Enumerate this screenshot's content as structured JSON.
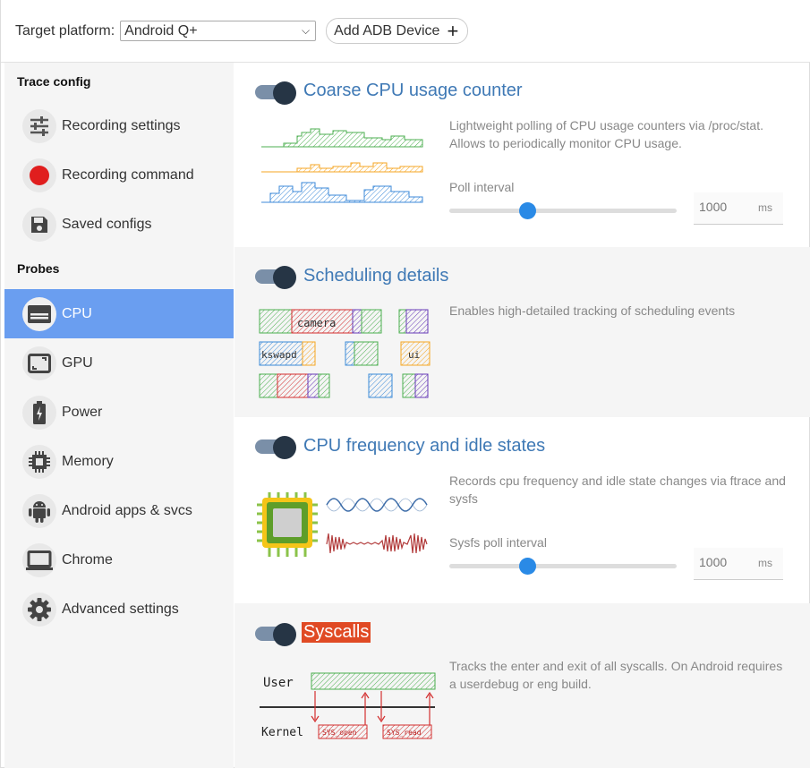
{
  "header": {
    "target_label": "Target platform:",
    "platform_value": "Android Q+",
    "add_device_label": "Add ADB Device",
    "add_icon": "plus-icon"
  },
  "sidebar": {
    "trace_config_heading": "Trace config",
    "probes_heading": "Probes",
    "trace_items": [
      {
        "label": "Recording settings",
        "icon": "sliders-icon"
      },
      {
        "label": "Recording command",
        "icon": "record-dot-icon"
      },
      {
        "label": "Saved configs",
        "icon": "save-icon"
      }
    ],
    "probe_items": [
      {
        "label": "CPU",
        "icon": "cpu-icon",
        "active": true
      },
      {
        "label": "GPU",
        "icon": "gpu-icon"
      },
      {
        "label": "Power",
        "icon": "battery-icon"
      },
      {
        "label": "Memory",
        "icon": "memory-chip-icon"
      },
      {
        "label": "Android apps & svcs",
        "icon": "android-icon"
      },
      {
        "label": "Chrome",
        "icon": "laptop-icon"
      },
      {
        "label": "Advanced settings",
        "icon": "gear-icon"
      }
    ],
    "accent_color": "#6a9ef0"
  },
  "probes": {
    "coarse_cpu": {
      "title": "Coarse CPU usage counter",
      "description": "Lightweight polling of CPU usage counters via /proc/stat. Allows to periodically monitor CPU usage.",
      "slider_label": "Poll interval",
      "value": "1000",
      "unit": "ms",
      "enabled": true
    },
    "scheduling": {
      "title": "Scheduling details",
      "description": "Enables high-detailed tracking of scheduling events",
      "illus_labels": {
        "camera": "camera",
        "kswapd": "kswapd",
        "ui": "ui"
      },
      "enabled": true
    },
    "cpu_freq": {
      "title": "CPU frequency and idle states",
      "description": "Records cpu frequency and idle state changes via ftrace and sysfs",
      "slider_label": "Sysfs poll interval",
      "value": "1000",
      "unit": "ms",
      "enabled": true
    },
    "syscalls": {
      "title": "Syscalls",
      "description": "Tracks the enter and exit of all syscalls. On Android requires a userdebug or eng build.",
      "illus_labels": {
        "user": "User",
        "kernel": "Kernel",
        "sys_open": "SYS_open",
        "sys_read": "SYS_read"
      },
      "enabled": true,
      "highlight_color": "#e04a24"
    }
  },
  "colors": {
    "title_blue": "#3f79b5",
    "slider_blue": "#2a8ae6",
    "toggle_knob": "#263545"
  }
}
